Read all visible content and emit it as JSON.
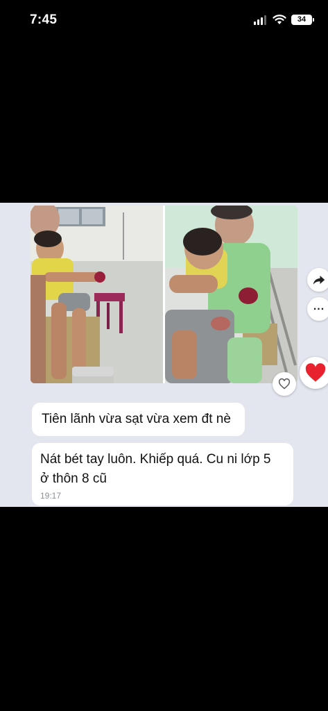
{
  "status_bar": {
    "time": "7:45",
    "battery_level": "34",
    "icons": [
      "signal-icon",
      "wifi-icon",
      "battery-icon"
    ]
  },
  "chat": {
    "photos": [
      {
        "name": "photo-left"
      },
      {
        "name": "photo-right"
      }
    ],
    "messages": [
      {
        "text": "Tiên lãnh vừa sạt vừa xem đt nè"
      },
      {
        "text_line1": "Nát bét tay luôn. Khiếp quá. Cu ni lớp 5",
        "text_line2": "ở thôn 8 cũ",
        "time": "19:17"
      }
    ],
    "actions": {
      "like_icon": "heart-outline-icon",
      "share_icon": "share-arrow-icon",
      "more_icon": "more-dots-icon",
      "more_label": "...",
      "reaction_icon": "heart-filled-icon"
    }
  },
  "colors": {
    "panel_bg": "#e3e6ef",
    "bubble_bg": "#ffffff",
    "heart_red": "#e8232f",
    "time_gray": "#8a8f99"
  }
}
